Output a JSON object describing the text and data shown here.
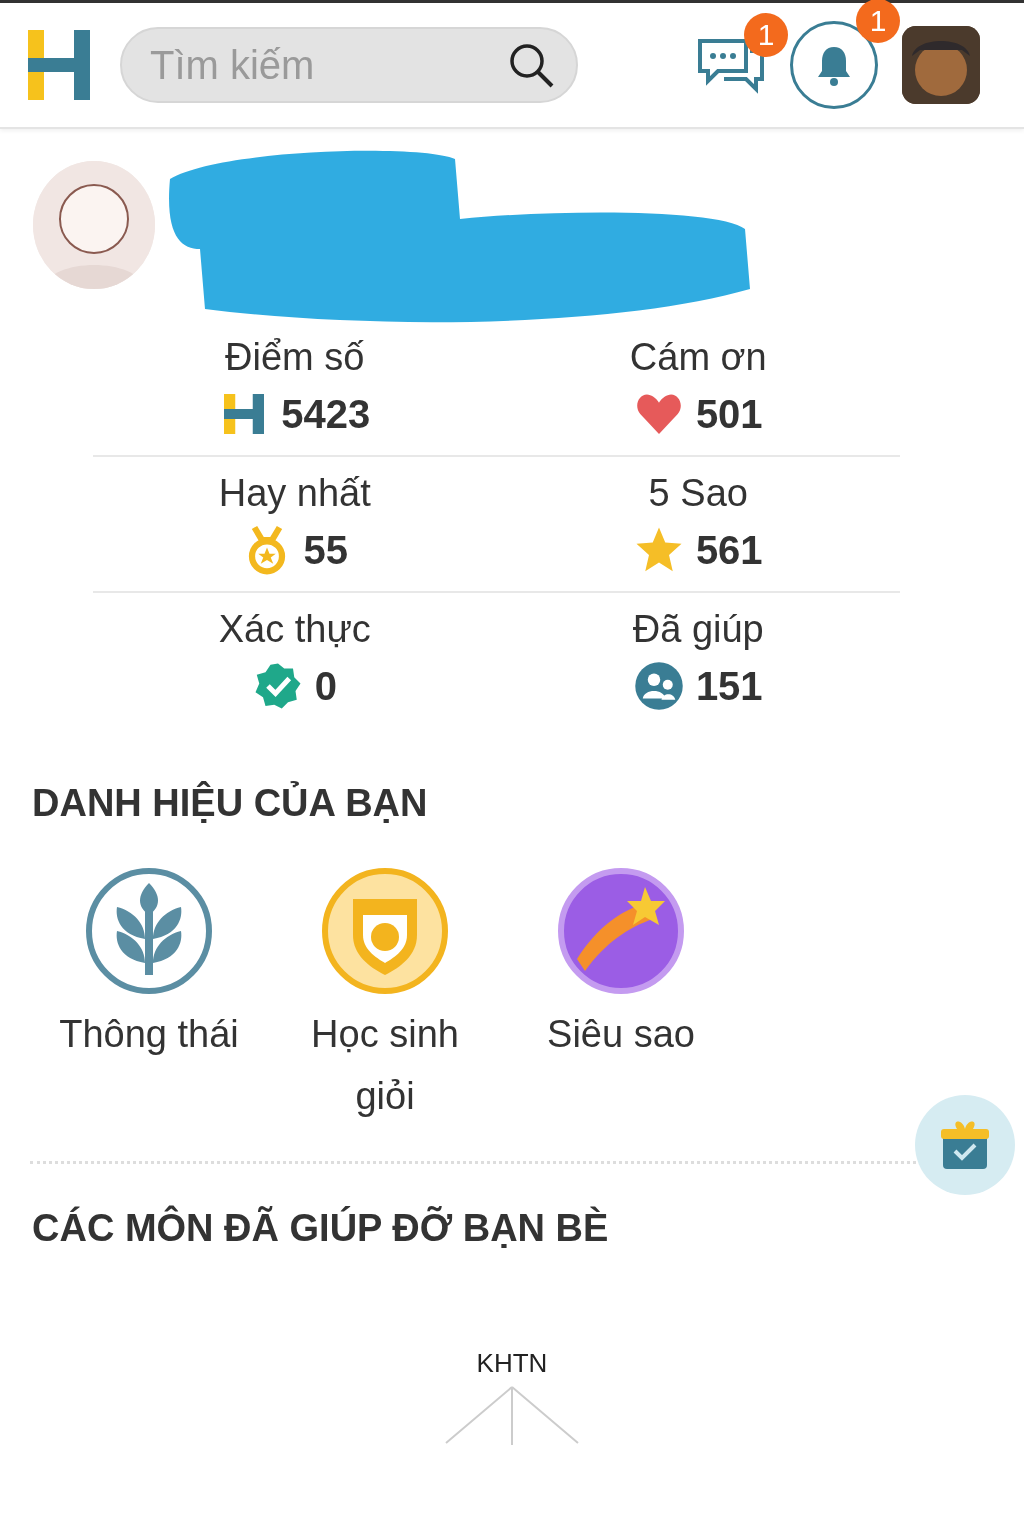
{
  "header": {
    "search": {
      "placeholder": "Tìm kiếm"
    },
    "messages_badge": "1",
    "notifications_badge": "1"
  },
  "profile": {
    "stats": [
      {
        "kind": "score",
        "label": "Điểm số",
        "value": "5423"
      },
      {
        "kind": "thanks",
        "label": "Cám ơn",
        "value": "501"
      },
      {
        "kind": "best",
        "label": "Hay nhất",
        "value": "55"
      },
      {
        "kind": "stars",
        "label": "5 Sao",
        "value": "561"
      },
      {
        "kind": "verified",
        "label": "Xác thực",
        "value": "0"
      },
      {
        "kind": "helped",
        "label": "Đã giúp",
        "value": "151"
      }
    ]
  },
  "titles_section": {
    "heading": "DANH HIỆU CỦA BẠN",
    "badges": [
      {
        "kind": "wheat",
        "label": "Thông thái"
      },
      {
        "kind": "shield",
        "label": "Học sinh giỏi"
      },
      {
        "kind": "comet",
        "label": "Siêu sao"
      }
    ]
  },
  "subjects_section": {
    "heading": "CÁC MÔN ĐÃ GIÚP ĐỠ BẠN BÈ",
    "chart_labels": [
      "KHTN"
    ]
  }
}
